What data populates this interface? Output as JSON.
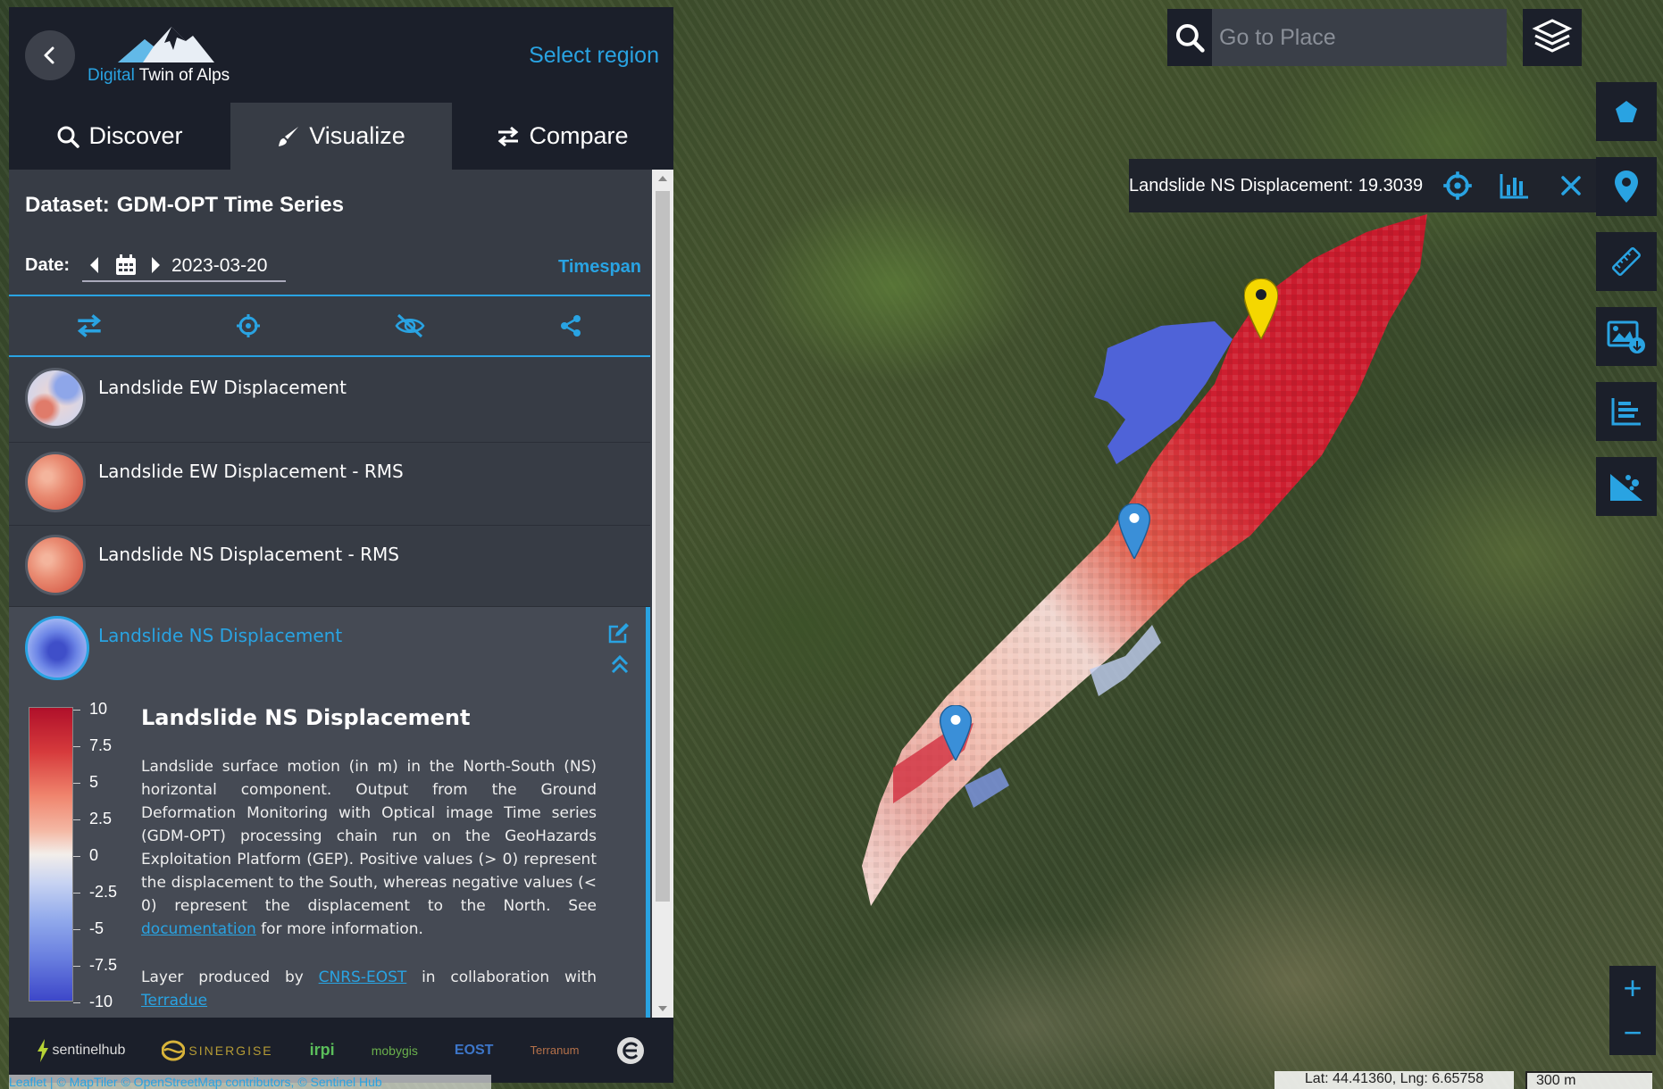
{
  "app": {
    "logo_prefix": "Digital",
    "logo_suffix": "Twin of Alps",
    "select_region": "Select region"
  },
  "tabs": [
    {
      "label": "Discover",
      "icon": "search-icon"
    },
    {
      "label": "Visualize",
      "icon": "brush-icon",
      "active": true
    },
    {
      "label": "Compare",
      "icon": "swap-icon"
    }
  ],
  "dataset": {
    "label": "Dataset:",
    "name": "GDM-OPT Time Series"
  },
  "date": {
    "label": "Date:",
    "value": "2023-03-20",
    "timespan": "Timespan"
  },
  "toolbar": [
    "swap-layers-icon",
    "crosshair-icon",
    "hide-icon",
    "share-icon"
  ],
  "layers": [
    {
      "name": "Landslide EW Displacement",
      "thumb": "mix"
    },
    {
      "name": "Landslide EW Displacement - RMS",
      "thumb": "red"
    },
    {
      "name": "Landslide NS Displacement - RMS",
      "thumb": "red"
    }
  ],
  "expanded_layer": {
    "name": "Landslide NS Displacement",
    "title": "Landslide NS Displacement",
    "description_main": "Landslide surface motion (in m) in the North-South (NS) horizontal component. Output from the Ground Deformation Monitoring with Optical image Time series (GDM-OPT) processing chain run on the GeoHazards Exploitation Platform (GEP). Positive values (> 0) represent the displacement to the South, whereas negative values (< 0) represent the displacement to the North. See",
    "description_link": "documentation",
    "description_tail": "for more information.",
    "produced_prefix": "Layer produced by",
    "produced_link": "CNRS-EOST",
    "produced_mid": "in collaboration with",
    "produced_link2": "Terradue",
    "legend_ticks": [
      "10",
      "7.5",
      "5",
      "2.5",
      "0",
      "-2.5",
      "-5",
      "-7.5",
      "-10"
    ],
    "legend_colors": {
      "max": "#b0102a",
      "mid": "#f3eeea",
      "min": "#3d47c9"
    }
  },
  "footer_logos": [
    "sentinelhub",
    "SINERGISE",
    "irpi",
    "mobygis",
    "EOST",
    "Terranum"
  ],
  "attribution": "Leaflet | © MapTiler © OpenStreetMap contributors, © Sentinel Hub",
  "search": {
    "placeholder": "Go to Place"
  },
  "value_popup": {
    "text": "Landslide NS Displacement: 19.3039"
  },
  "right_tools": [
    "polygon-icon",
    "location-pin-icon",
    "ruler-icon",
    "image-download-icon",
    "chart-icon",
    "landslide-icon"
  ],
  "zoom": {
    "in": "+",
    "out": "−"
  },
  "coords": "Lat: 44.41360, Lng: 6.65758",
  "scale": "300 m",
  "colors": {
    "accent": "#29a3e2",
    "panel": "#373c45",
    "dark": "#1b1f2a",
    "pin_yellow": "#f5d700",
    "pin_blue": "#3a8fd8"
  }
}
